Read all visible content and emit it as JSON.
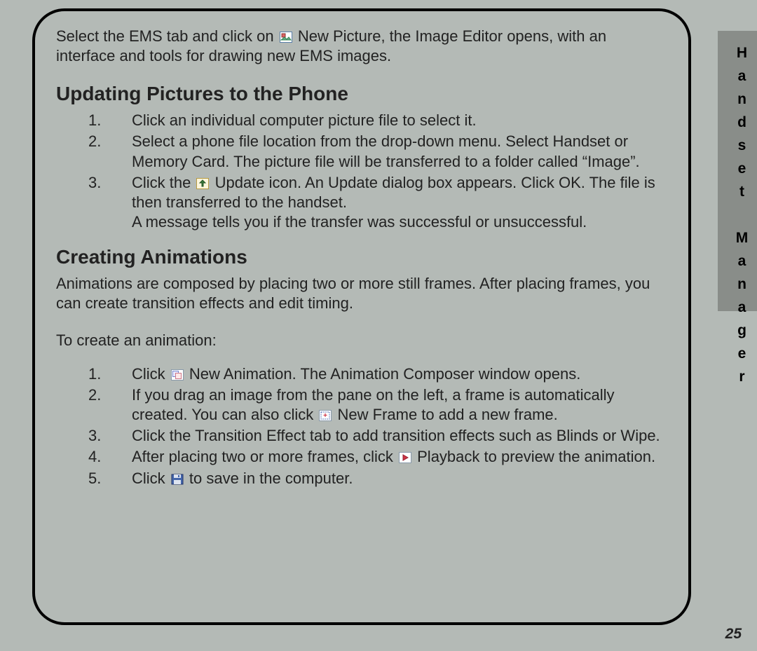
{
  "sideTab": "Handset Manager",
  "pageNumber": "25",
  "intro": {
    "pre": "Select the EMS tab and click on ",
    "post": " New Picture, the Image Editor opens, with an interface and tools for drawing new EMS images."
  },
  "section1": {
    "heading": "Updating Pictures to the Phone",
    "items": [
      {
        "n": "1.",
        "text": "Click an individual computer picture file to select it."
      },
      {
        "n": "2.",
        "text": "Select a phone file location from the drop-down menu. Select Handset or Memory Card. The picture file will be transferred  to a folder called “Image”."
      },
      {
        "n": "3.",
        "pre": "Click the ",
        "post": " Update icon. An Update dialog box appears. Click OK. The file is then transferred to the handset.\nA message tells you if the transfer was successful or unsuccessful."
      }
    ]
  },
  "section2": {
    "heading": "Creating Animations",
    "body": "Animations are composed by placing two or more still frames. After placing frames, you can create transition effects and edit timing.",
    "lead": "To create an animation:",
    "items": [
      {
        "n": "1.",
        "pre": "Click  ",
        "post": " New Animation. The Animation Composer window opens."
      },
      {
        "n": "2.",
        "pre": "If you drag an image from the pane on the left, a frame is automatically created. You can also click ",
        "post": " New Frame to add a new frame."
      },
      {
        "n": "3.",
        "text": "Click the Transition Effect tab to add transition effects  such as Blinds or Wipe."
      },
      {
        "n": "4.",
        "pre": "After placing two or more frames, click ",
        "post": " Playback to preview the animation."
      },
      {
        "n": "5.",
        "pre": "Click ",
        "post": " to save in the computer."
      }
    ]
  }
}
